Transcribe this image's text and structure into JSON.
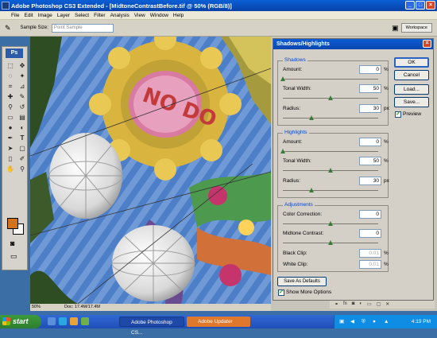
{
  "app": {
    "title": "Adobe Photoshop CS3 Extended - [MidtoneContrastBefore.tif @ 50% (RGB/8)]"
  },
  "menu": [
    "File",
    "Edit",
    "Image",
    "Layer",
    "Select",
    "Filter",
    "Analysis",
    "View",
    "Window",
    "Help"
  ],
  "options": {
    "sample_size_label": "Sample Size:",
    "sample_size_value": "Point Sample",
    "workspace_label": "Workspace"
  },
  "toolbox": {
    "logo": "Ps"
  },
  "status": {
    "zoom": "50%",
    "doc": "Doc: 17.4M/17.4M"
  },
  "dialog": {
    "title": "Shadows/Highlights",
    "shadows": {
      "legend": "Shadows",
      "amount_label": "Amount:",
      "amount": "0",
      "amount_unit": "%",
      "tonal_label": "Tonal Width:",
      "tonal": "50",
      "tonal_unit": "%",
      "radius_label": "Radius:",
      "radius": "30",
      "radius_unit": "px",
      "amount_level": 0,
      "tonal_level": 50,
      "radius_level": 30
    },
    "highlights": {
      "legend": "Highlights",
      "amount_label": "Amount:",
      "amount": "0",
      "amount_unit": "%",
      "tonal_label": "Tonal Width:",
      "tonal": "50",
      "tonal_unit": "%",
      "radius_label": "Radius:",
      "radius": "30",
      "radius_unit": "px",
      "amount_level": 0,
      "tonal_level": 50,
      "radius_level": 30
    },
    "adjustments": {
      "legend": "Adjustments",
      "color_label": "Color Correction:",
      "color": "0",
      "midtone_label": "Midtone Contrast:",
      "midtone": "0",
      "black_label": "Black Clip:",
      "black": "0.01",
      "black_unit": "%",
      "white_label": "White Clip:",
      "white": "0.01",
      "white_unit": "%",
      "color_level": 0,
      "midtone_level": 0
    },
    "buttons": {
      "ok": "OK",
      "cancel": "Cancel",
      "load": "Load...",
      "save": "Save..."
    },
    "preview_label": "Preview",
    "preview_checked": true,
    "save_defaults": "Save As Defaults",
    "show_more": "Show More Options",
    "show_more_checked": true
  },
  "taskbar": {
    "start": "start",
    "tasks": [
      "Adobe Photoshop CS...",
      "Adobe Updater"
    ],
    "clock": "4:19 PM"
  },
  "sign_text": "NO DO"
}
